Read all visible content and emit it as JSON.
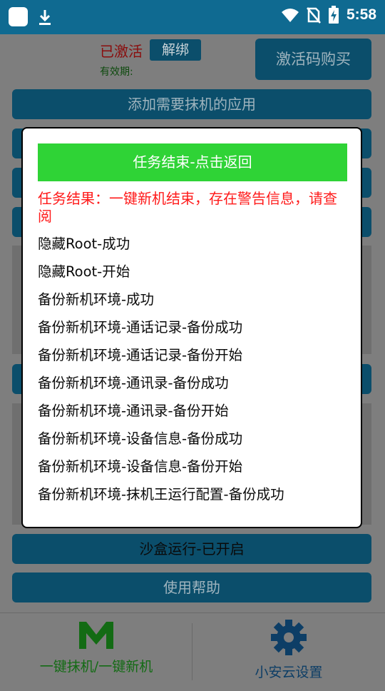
{
  "status_bar": {
    "time": "5:58",
    "icons": [
      "app-notification-icon",
      "download-icon",
      "wifi-icon",
      "no-sim-icon",
      "battery-charging-icon"
    ]
  },
  "app": {
    "activation_status": "已激活",
    "unbind_label": "解绑",
    "validity_label": "有效期:",
    "buy_code_label": "激活码购买",
    "add_apps_label": "添加需要抹机的应用",
    "sandbox_label": "沙盒运行-已开启",
    "help_label": "使用帮助"
  },
  "bottom_nav": [
    {
      "label": "一键抹机/一键新机",
      "icon": "m-logo-icon"
    },
    {
      "label": "小安云设置",
      "icon": "gear-icon"
    }
  ],
  "dialog": {
    "return_label": "任务结束-点击返回",
    "result_text": "任务结果：一键新机结束，存在警告信息，请查阅",
    "log_items": [
      "隐藏Root-成功",
      "隐藏Root-开始",
      "备份新机环境-成功",
      "备份新机环境-通话记录-备份成功",
      "备份新机环境-通话记录-备份开始",
      "备份新机环境-通讯录-备份成功",
      "备份新机环境-通讯录-备份开始",
      "备份新机环境-设备信息-备份成功",
      "备份新机环境-设备信息-备份开始",
      "备份新机环境-抹机王运行配置-备份成功"
    ]
  },
  "colors": {
    "status_bar": "#0f6a91",
    "return_button": "#2fd336",
    "result_text": "#ff1a1a",
    "dim_button": "#0b4e6b"
  }
}
